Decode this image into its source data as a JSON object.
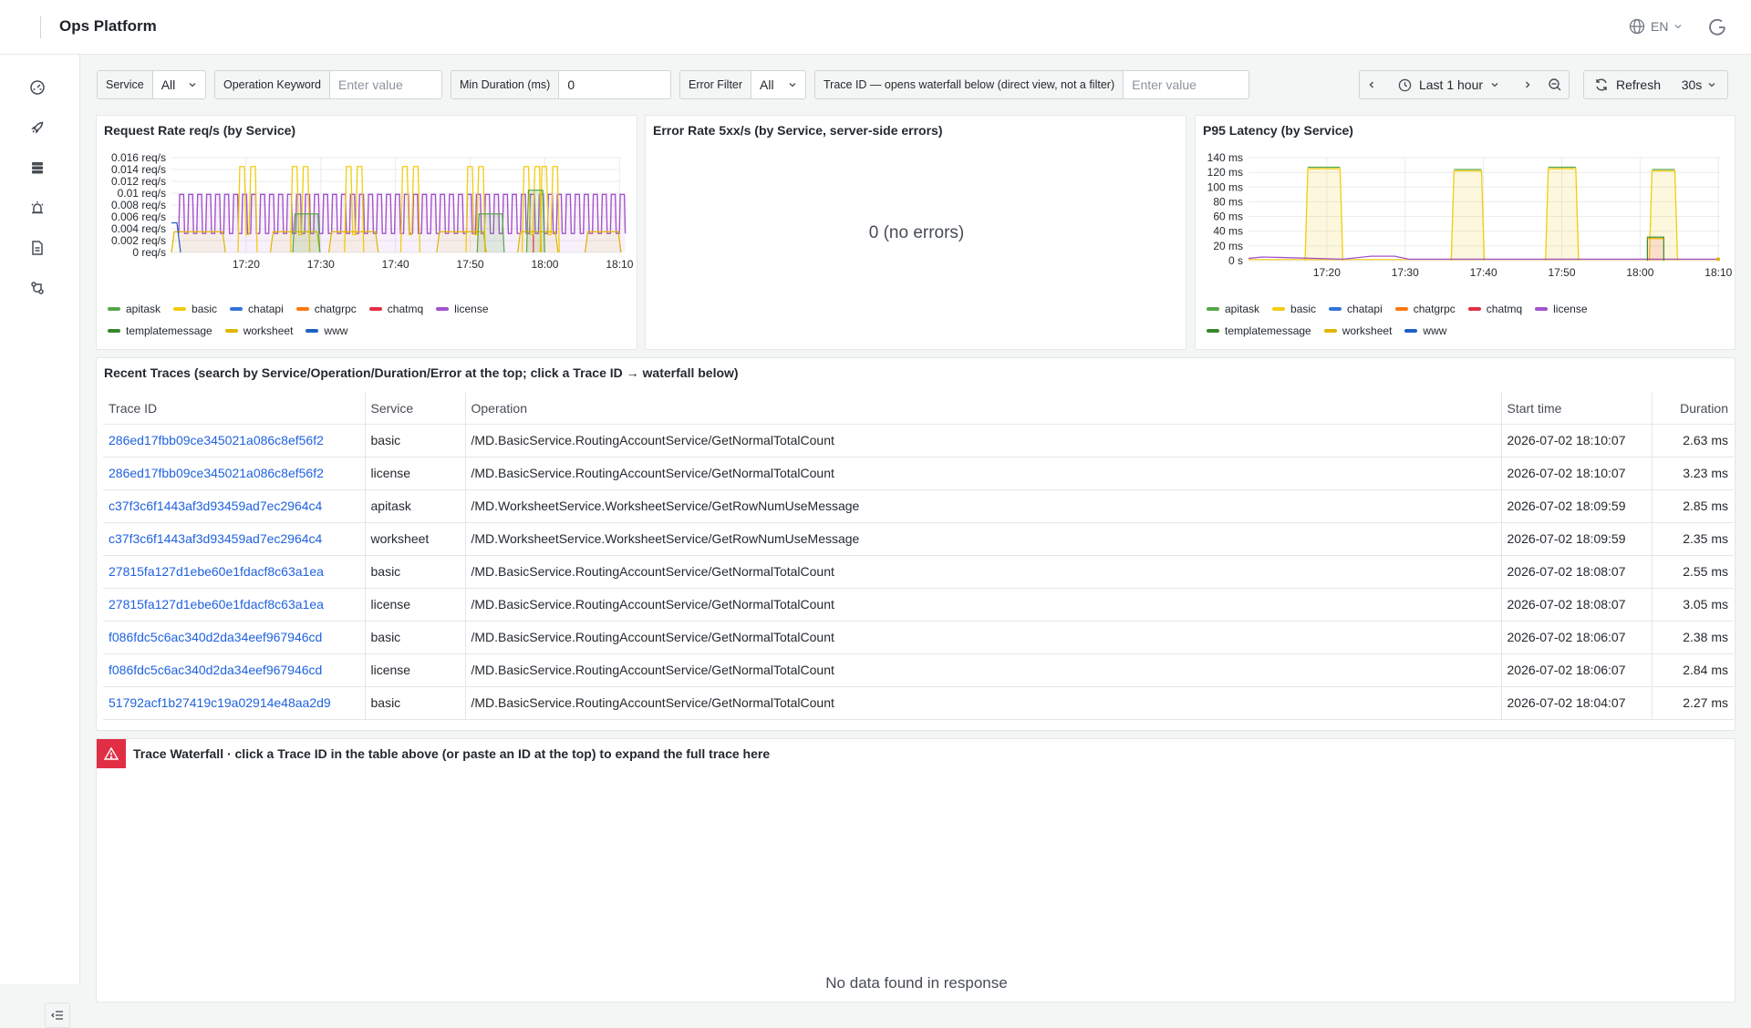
{
  "app": {
    "title": "Ops Platform",
    "language": "EN"
  },
  "sidebar": {
    "icons": [
      "dashboard-icon",
      "rocket-icon",
      "database-icon",
      "alert-icon",
      "document-icon",
      "workflow-icon"
    ]
  },
  "filters": {
    "service": {
      "label": "Service",
      "value": "All"
    },
    "operation": {
      "label": "Operation Keyword",
      "placeholder": "Enter value"
    },
    "min_duration": {
      "label": "Min Duration (ms)",
      "value": "0"
    },
    "error": {
      "label": "Error Filter",
      "value": "All"
    },
    "trace_id": {
      "label": "Trace ID — opens waterfall below (direct view, not a filter)",
      "placeholder": "Enter value"
    }
  },
  "timepicker": {
    "range": "Last 1 hour",
    "refresh": "Refresh",
    "interval": "30s"
  },
  "colors": {
    "apitask": "#56a64b",
    "basic": "#f2cc0c",
    "chatapi": "#3274d9",
    "chatgrpc": "#ff780a",
    "chatmq": "#e02f44",
    "license": "#a352cc",
    "templatemessage": "#37872d",
    "worksheet": "#e0b400",
    "www": "#1f60c4"
  },
  "legend": [
    "apitask",
    "basic",
    "chatapi",
    "chatgrpc",
    "chatmq",
    "license",
    "templatemessage",
    "worksheet",
    "www"
  ],
  "panels": {
    "request_rate": {
      "title": "Request Rate req/s (by Service)"
    },
    "error_rate": {
      "title": "Error Rate 5xx/s (by Service, server-side errors)",
      "empty": "0 (no errors)"
    },
    "p95": {
      "title": "P95 Latency (by Service)"
    }
  },
  "chart_data": [
    {
      "type": "line",
      "title": "Request Rate req/s (by Service)",
      "y_ticks": [
        "0.016 req/s",
        "0.014 req/s",
        "0.012 req/s",
        "0.01 req/s",
        "0.008 req/s",
        "0.006 req/s",
        "0.004 req/s",
        "0.002 req/s",
        "0 req/s"
      ],
      "x_ticks": [
        "17:20",
        "17:30",
        "17:40",
        "17:50",
        "18:00",
        "18:10"
      ],
      "ylim": [
        0,
        0.016
      ],
      "xlim": [
        "17:10",
        "18:10"
      ],
      "series": [
        {
          "name": "license",
          "pattern": "periodic pulses 0.003 to 0.01"
        },
        {
          "name": "basic",
          "pattern": "bursts up to 0.0145 around 17:18, 17:31, 17:47, 18:01"
        },
        {
          "name": "apitask",
          "values_peak": 0.0105
        },
        {
          "name": "worksheet",
          "values_peak": 0.0035
        }
      ]
    },
    {
      "type": "line",
      "title": "Error Rate 5xx/s (by Service, server-side errors)",
      "series": []
    },
    {
      "type": "area",
      "title": "P95 Latency (by Service)",
      "y_ticks": [
        "140 ms",
        "120 ms",
        "100 ms",
        "80 ms",
        "60 ms",
        "40 ms",
        "20 ms",
        "0 s"
      ],
      "x_ticks": [
        "17:20",
        "17:30",
        "17:40",
        "17:50",
        "18:00",
        "18:10"
      ],
      "ylim": [
        0,
        140
      ],
      "series": [
        {
          "name": "basic",
          "plateaus": [
            [
              17.8,
              125
            ],
            [
              17.48,
              122
            ],
            [
              17.8,
              125
            ],
            [
              17.98,
              122
            ]
          ]
        },
        {
          "name": "worksheet",
          "values_peak": 32
        },
        {
          "name": "license",
          "values_peak": 5
        }
      ]
    }
  ],
  "traces": {
    "title": "Recent Traces (search by Service/Operation/Duration/Error at the top; click a Trace ID → waterfall below)",
    "columns": [
      "Trace ID",
      "Service",
      "Operation",
      "Start time",
      "Duration"
    ],
    "rows": [
      [
        "286ed17fbb09ce345021a086c8ef56f2",
        "basic",
        "/MD.BasicService.RoutingAccountService/GetNormalTotalCount",
        "2026-07-02 18:10:07",
        "2.63 ms"
      ],
      [
        "286ed17fbb09ce345021a086c8ef56f2",
        "license",
        "/MD.BasicService.RoutingAccountService/GetNormalTotalCount",
        "2026-07-02 18:10:07",
        "3.23 ms"
      ],
      [
        "c37f3c6f1443af3d93459ad7ec2964c4",
        "apitask",
        "/MD.WorksheetService.WorksheetService/GetRowNumUseMessage",
        "2026-07-02 18:09:59",
        "2.85 ms"
      ],
      [
        "c37f3c6f1443af3d93459ad7ec2964c4",
        "worksheet",
        "/MD.WorksheetService.WorksheetService/GetRowNumUseMessage",
        "2026-07-02 18:09:59",
        "2.35 ms"
      ],
      [
        "27815fa127d1ebe60e1fdacf8c63a1ea",
        "basic",
        "/MD.BasicService.RoutingAccountService/GetNormalTotalCount",
        "2026-07-02 18:08:07",
        "2.55 ms"
      ],
      [
        "27815fa127d1ebe60e1fdacf8c63a1ea",
        "license",
        "/MD.BasicService.RoutingAccountService/GetNormalTotalCount",
        "2026-07-02 18:08:07",
        "3.05 ms"
      ],
      [
        "f086fdc5c6ac340d2da34eef967946cd",
        "basic",
        "/MD.BasicService.RoutingAccountService/GetNormalTotalCount",
        "2026-07-02 18:06:07",
        "2.38 ms"
      ],
      [
        "f086fdc5c6ac340d2da34eef967946cd",
        "license",
        "/MD.BasicService.RoutingAccountService/GetNormalTotalCount",
        "2026-07-02 18:06:07",
        "2.84 ms"
      ],
      [
        "51792acf1b27419c19a02914e48aa2d9",
        "basic",
        "/MD.BasicService.RoutingAccountService/GetNormalTotalCount",
        "2026-07-02 18:04:07",
        "2.27 ms"
      ]
    ]
  },
  "waterfall": {
    "title": "Trace Waterfall · click a Trace ID in the table above (or paste an ID at the top) to expand the full trace here",
    "empty": "No data found in response"
  }
}
